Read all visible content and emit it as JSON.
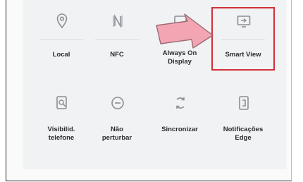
{
  "quick_panel": {
    "tiles": [
      {
        "id": "location",
        "label": "Local",
        "icon": "location-pin-icon"
      },
      {
        "id": "nfc",
        "label": "NFC",
        "icon": "nfc-icon"
      },
      {
        "id": "always-on-display",
        "label": "Always On\nDisplay",
        "icon": "always-on-display-icon"
      },
      {
        "id": "smart-view",
        "label": "Smart View",
        "icon": "smart-view-icon"
      },
      {
        "id": "phone-visibility",
        "label": "Visibilid.\ntelefone",
        "icon": "phone-visibility-icon"
      },
      {
        "id": "do-not-disturb",
        "label": "Não\nperturbar",
        "icon": "do-not-disturb-icon"
      },
      {
        "id": "sync",
        "label": "Sincronizar",
        "icon": "sync-icon"
      },
      {
        "id": "edge-notifications",
        "label": "Notificações\nEdge",
        "icon": "edge-notifications-icon"
      }
    ],
    "highlighted_tile": "smart-view",
    "colors": {
      "highlight_border": "#d0303a",
      "arrow_fill": "#f3a5b3",
      "icon_gray": "#8a8f96"
    }
  }
}
